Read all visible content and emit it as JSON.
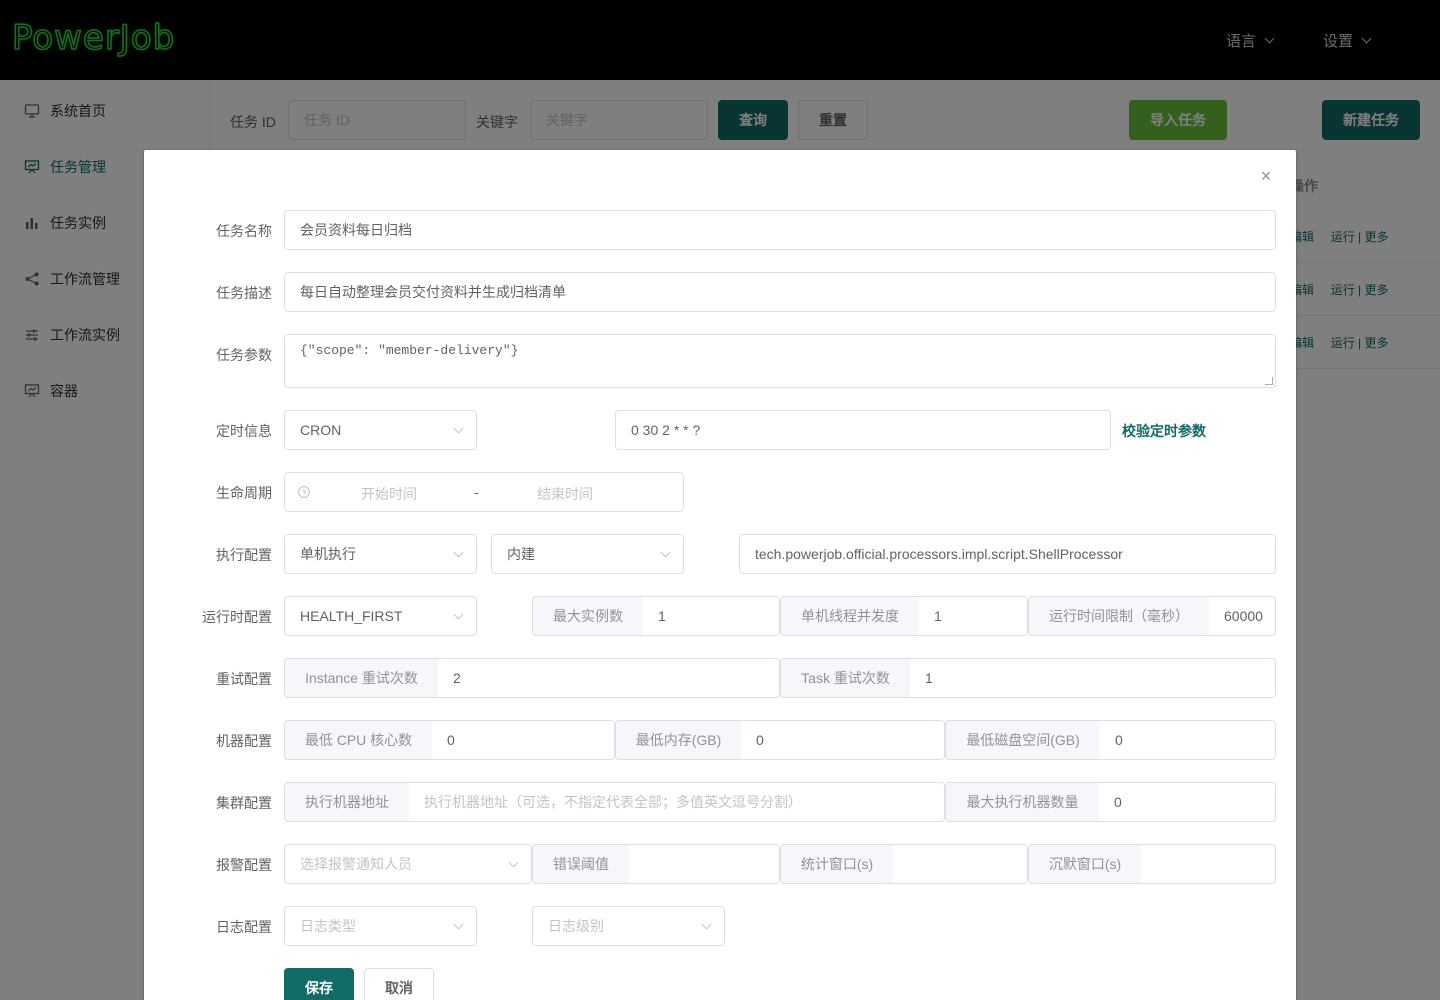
{
  "header": {
    "logo": "PowerJob",
    "menu_language": "语言",
    "menu_settings": "设置"
  },
  "sidebar": {
    "items": [
      {
        "label": "系统首页",
        "icon": "monitor-icon"
      },
      {
        "label": "任务管理",
        "icon": "presentation-icon"
      },
      {
        "label": "任务实例",
        "icon": "bar-chart-icon"
      },
      {
        "label": "工作流管理",
        "icon": "share-icon"
      },
      {
        "label": "工作流实例",
        "icon": "sliders-icon"
      },
      {
        "label": "容器",
        "icon": "presentation-icon"
      }
    ]
  },
  "toolbar": {
    "job_id_label": "任务 ID",
    "job_id_placeholder": "任务 ID",
    "keyword_label": "关键字",
    "keyword_placeholder": "关键字",
    "query": "查询",
    "reset": "重置",
    "import": "导入任务",
    "new_job": "新建任务"
  },
  "table": {
    "op_header": "操作",
    "rows": [
      {
        "edit": "编辑",
        "run": "运行",
        "more": "更多"
      },
      {
        "edit": "编辑",
        "run": "运行",
        "more": "更多"
      },
      {
        "edit": "编辑",
        "run": "运行",
        "more": "更多"
      }
    ]
  },
  "dialog": {
    "close": "×",
    "job_name": {
      "label": "任务名称",
      "value": "会员资料每日归档"
    },
    "job_desc": {
      "label": "任务描述",
      "value": "每日自动整理会员交付资料并生成归档清单"
    },
    "job_params": {
      "label": "任务参数",
      "value": "{\"scope\": \"member-delivery\"}"
    },
    "timing": {
      "label": "定时信息",
      "type": "CRON",
      "expression": "0 30 2 * * ?",
      "validate": "校验定时参数"
    },
    "lifecycle": {
      "label": "生命周期",
      "start_placeholder": "开始时间",
      "separator": "-",
      "end_placeholder": "结束时间"
    },
    "execution": {
      "label": "执行配置",
      "mode": "单机执行",
      "processor_type": "内建",
      "processor": "tech.powerjob.official.processors.impl.script.ShellProcessor"
    },
    "runtime": {
      "label": "运行时配置",
      "dispatch": "HEALTH_FIRST",
      "max_instances_label": "最大实例数",
      "max_instances": "1",
      "concurrency_label": "单机线程并发度",
      "concurrency": "1",
      "time_limit_label": "运行时间限制（毫秒）",
      "time_limit": "60000"
    },
    "retry": {
      "label": "重试配置",
      "instance_label": "Instance 重试次数",
      "instance_value": "2",
      "task_label": "Task 重试次数",
      "task_value": "1"
    },
    "machine": {
      "label": "机器配置",
      "cpu_label": "最低 CPU 核心数",
      "cpu_value": "0",
      "mem_label": "最低内存(GB)",
      "mem_value": "0",
      "disk_label": "最低磁盘空间(GB)",
      "disk_value": "0"
    },
    "cluster": {
      "label": "集群配置",
      "address_label": "执行机器地址",
      "address_placeholder": "执行机器地址（可选，不指定代表全部；多值英文逗号分割）",
      "max_workers_label": "最大执行机器数量",
      "max_workers_value": "0"
    },
    "alarm": {
      "label": "报警配置",
      "receivers_placeholder": "选择报警通知人员",
      "threshold_label": "错误阈值",
      "window_label": "统计窗口(s)",
      "silence_label": "沉默窗口(s)"
    },
    "log": {
      "label": "日志配置",
      "type_placeholder": "日志类型",
      "level_placeholder": "日志级别"
    },
    "save": "保存",
    "cancel": "取消"
  }
}
